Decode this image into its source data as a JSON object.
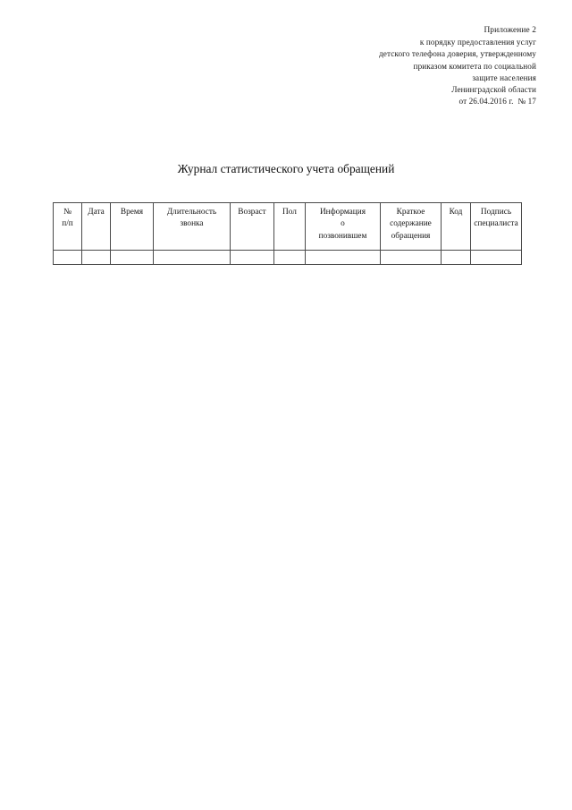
{
  "document": {
    "page_background": "#ffffff",
    "text_color": "#000000"
  },
  "header": {
    "lines": [
      "Приложение 2",
      "к порядку предоставления услуг",
      "детского телефона доверия, утвержденному",
      "приказом комитета по социальной",
      "защите населения",
      "Ленинградской области",
      "от 26.04.2016 г.  № 17"
    ]
  },
  "title": {
    "text": "Журнал статистического учета обращений"
  },
  "table": {
    "border_color": "#4a4a4a",
    "columns": [
      {
        "key": "num",
        "lines": [
          "№",
          "п/п"
        ]
      },
      {
        "key": "date",
        "lines": [
          "Дата"
        ]
      },
      {
        "key": "time",
        "lines": [
          "Время"
        ]
      },
      {
        "key": "duration",
        "lines": [
          "Длительность",
          "звонка"
        ]
      },
      {
        "key": "age",
        "lines": [
          "Возраст"
        ]
      },
      {
        "key": "sex",
        "lines": [
          "Пол"
        ]
      },
      {
        "key": "info",
        "lines": [
          "Информация",
          "о",
          "позвонившем"
        ]
      },
      {
        "key": "brief",
        "lines": [
          "Краткое",
          "содержание",
          "обращения"
        ]
      },
      {
        "key": "code",
        "lines": [
          "Код"
        ]
      },
      {
        "key": "sign",
        "lines": [
          "Подпись",
          "специалиста"
        ]
      }
    ],
    "rows": [
      {
        "num": "",
        "date": "",
        "time": "",
        "duration": "",
        "age": "",
        "sex": "",
        "info": "",
        "brief": "",
        "code": "",
        "sign": ""
      }
    ]
  }
}
